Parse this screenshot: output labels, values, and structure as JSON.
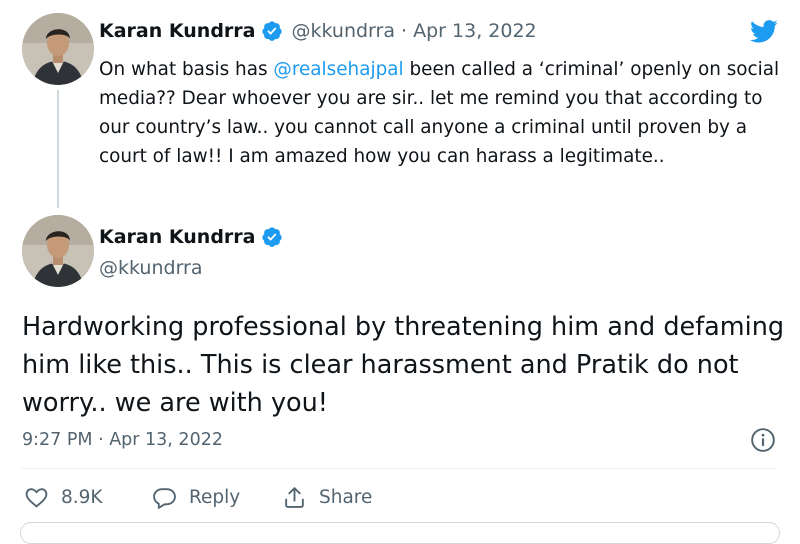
{
  "colors": {
    "accent": "#1d9bf0",
    "text_primary": "#0f1419",
    "text_secondary": "#536471",
    "divider": "#eff3f4"
  },
  "icons": [
    "twitter-bird-icon",
    "verified-badge-icon",
    "heart-icon",
    "reply-icon",
    "share-icon",
    "info-icon"
  ],
  "parent_tweet": {
    "author_name": "Karan Kundrra",
    "handle": "@kkundrra",
    "separator": " · ",
    "date": "Apr 13, 2022",
    "text_before_mention": "On what basis has ",
    "mention": "@realsehajpal",
    "text_after_mention": " been called a ‘criminal’ openly on social media?? Dear whoever you are sir.. let me remind you that according to our country’s law.. you cannot call anyone a criminal until proven by a court of law!! I am amazed how you can harass a legitimate.."
  },
  "main_tweet": {
    "author_name": "Karan Kundrra",
    "handle": "@kkundrra",
    "text": "Hardworking professional by threatening him and defaming him like this.. This is clear harassment and Pratik do not worry.. we are with you!",
    "timestamp": "9:27 PM · Apr 13, 2022",
    "actions": {
      "like_count": "8.9K",
      "reply_label": "Reply",
      "share_label": "Share"
    }
  }
}
